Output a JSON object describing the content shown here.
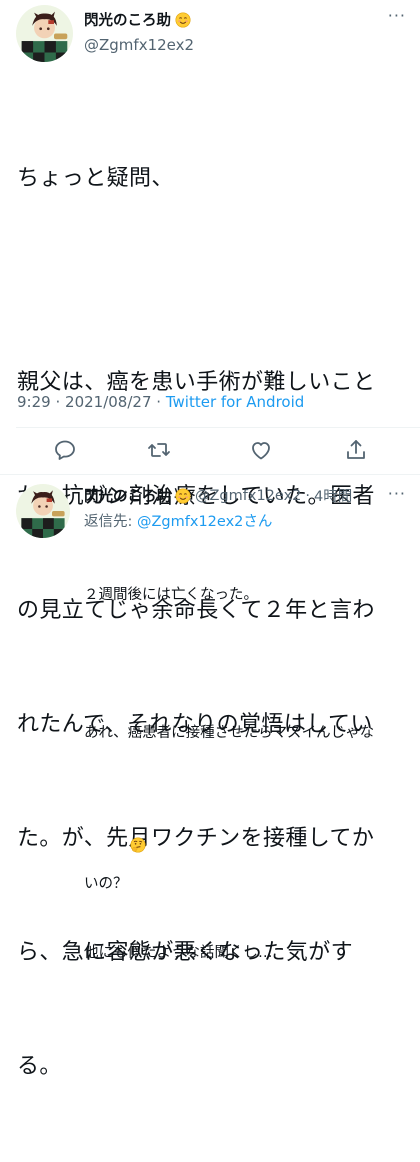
{
  "main_tweet": {
    "display_name": "閃光のころ助",
    "handle": "@Zgmfx12ex2",
    "text_lines": [
      "ちょっと疑問、",
      "",
      "親父は、癌を患い手術が難しいこと",
      "から抗ガン剤治療をしていた。医者",
      "の見立てじゃ余命長くて２年と言わ",
      "れたんで、それなりの覚悟はしてい",
      "た。が、先月ワクチンを接種してか",
      "ら、急に容態が悪くなった気がす",
      "る。"
    ],
    "time": "9:29",
    "date_sep": "·",
    "date": "2021/08/27",
    "source_sep": "·",
    "source": "Twitter for Android",
    "name_emoji": "smiling-face-emoji"
  },
  "actions": {
    "reply_icon": "reply-icon",
    "retweet_icon": "retweet-icon",
    "like_icon": "heart-icon",
    "share_icon": "share-icon"
  },
  "reply_tweet": {
    "display_name": "閃光のころ助",
    "handle": "@Zgmfx12ex2",
    "sep": "·",
    "time": "4時間",
    "replying_to_prefix": "返信先: ",
    "replying_to_mention": "@Zgmfx12ex2さん",
    "line_1": "２週間後には亡くなった。",
    "line_2": "",
    "line_3": "あれ、癌患者に接種させたらマズイんじゃな",
    "line_4": "いの？",
    "line_5": "他にも似たような話聞くし…",
    "thinking_emoji": "thinking-face-emoji"
  },
  "more_label": "···",
  "colors": {
    "text": "#0f1419",
    "secondary": "#536471",
    "link": "#1d9bf0",
    "divider": "#eff3f4"
  }
}
